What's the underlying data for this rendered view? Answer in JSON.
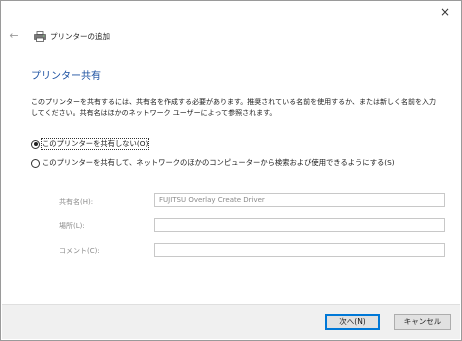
{
  "window": {
    "close_icon": "×",
    "back_icon": "←"
  },
  "header": {
    "title": "プリンターの追加"
  },
  "page": {
    "title": "プリンター共有",
    "description": "このプリンターを共有するには、共有名を作成する必要があります。推奨されている名前を使用するか、または新しく名前を入力してください。共有名はほかのネットワーク ユーザーによって参照されます。"
  },
  "options": {
    "no_share": "このプリンターを共有しない(O)",
    "share": "このプリンターを共有して、ネットワークのほかのコンピューターから検索および使用できるようにする(S)",
    "selected": "no_share"
  },
  "fields": {
    "share_name_label": "共有名(H):",
    "share_name_value": "FUJITSU Overlay Create Driver",
    "location_label": "場所(L):",
    "location_value": "",
    "comment_label": "コメント(C):",
    "comment_value": ""
  },
  "footer": {
    "next_label": "次へ(N)",
    "cancel_label": "キャンセル"
  }
}
